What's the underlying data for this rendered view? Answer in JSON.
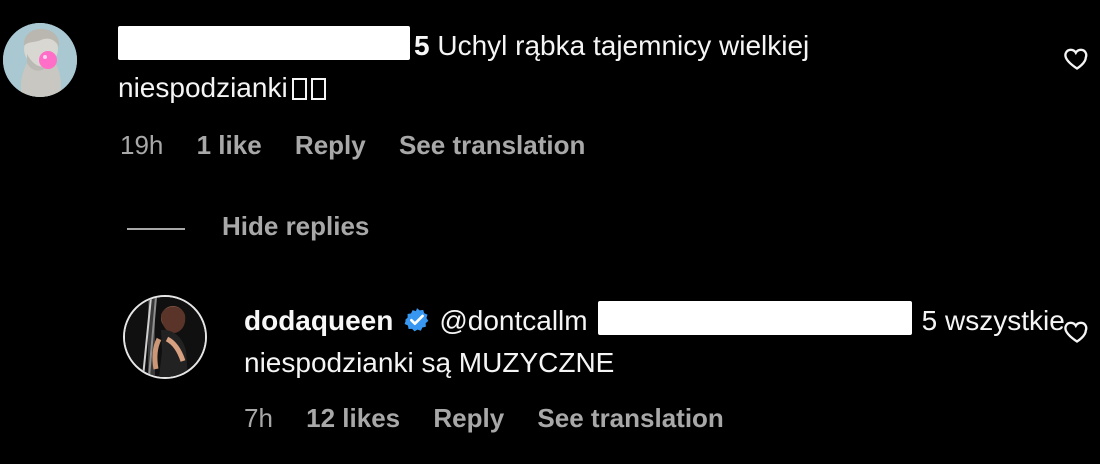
{
  "comments": [
    {
      "avatar": "statue-avatar",
      "username_suffix": "5",
      "text_line1": "Uchyl rąbka tajemnicy wielkiej",
      "text_line2": "niespodzianki",
      "time": "19h",
      "likes": "1 like",
      "reply": "Reply",
      "translation": "See translation",
      "like_icon": "heart-icon"
    },
    {
      "avatar": "profile-avatar",
      "username": "dodaqueen",
      "verified_icon": "verified-badge-icon",
      "mention_prefix": "@dontcallm",
      "mention_suffix": "5",
      "text_line1": "wszystkie",
      "text_line2": "niespodzianki są MUZYCZNE",
      "time": "7h",
      "likes": "12 likes",
      "reply": "Reply",
      "translation": "See translation",
      "like_icon": "heart-icon"
    }
  ],
  "replies_toggle": {
    "label": "Hide replies"
  },
  "colors": {
    "background": "#000000",
    "text": "#f5f5f5",
    "meta": "#a8a8a8",
    "verified": "#3897f0"
  }
}
